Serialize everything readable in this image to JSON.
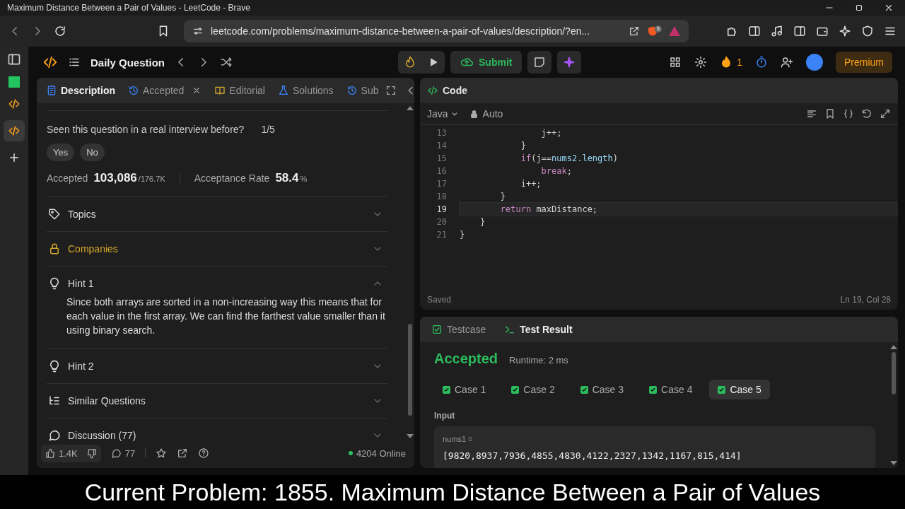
{
  "browser": {
    "title": "Maximum Distance Between a Pair of Values - LeetCode - Brave",
    "address": "leetcode.com/problems/maximum-distance-between-a-pair-of-values/description/?en...",
    "shield_count": "5"
  },
  "nav": {
    "title": "Daily Question",
    "submit": "Submit",
    "streak": "1",
    "premium": "Premium"
  },
  "left_panel": {
    "tabs": [
      {
        "label": "Description",
        "kind": "doc",
        "selected": true,
        "closable": false
      },
      {
        "label": "Accepted",
        "kind": "history",
        "selected": false,
        "closable": true
      },
      {
        "label": "Editorial",
        "kind": "book",
        "selected": false,
        "closable": false
      },
      {
        "label": "Solutions",
        "kind": "flask",
        "selected": false,
        "closable": false
      },
      {
        "label": "Sub",
        "kind": "history",
        "selected": false,
        "closable": false
      }
    ],
    "interview_question": "Seen this question in a real interview before?",
    "interview_count": "1/5",
    "answers": [
      "Yes",
      "No"
    ],
    "accepted_label": "Accepted",
    "accepted_value": "103,086",
    "accepted_total": "/176.7K",
    "rate_label": "Acceptance Rate",
    "rate_value": "58.4",
    "rate_unit": "%",
    "sections": [
      {
        "label": "Topics",
        "kind": "tag",
        "locked": false,
        "expanded": false
      },
      {
        "label": "Companies",
        "kind": "lock",
        "locked": true,
        "expanded": false
      },
      {
        "label": "Hint 1",
        "kind": "bulb",
        "locked": false,
        "expanded": true,
        "body": "Since both arrays are sorted in a non-increasing way this means that for each value in the first array. We can find the farthest value smaller than it using binary search."
      },
      {
        "label": "Hint 2",
        "kind": "bulb",
        "locked": false,
        "expanded": false
      },
      {
        "label": "Similar Questions",
        "kind": "list",
        "locked": false,
        "expanded": false
      },
      {
        "label": "Discussion (77)",
        "kind": "chat",
        "locked": false,
        "expanded": false
      }
    ],
    "likes": "1.4K",
    "comments": "77",
    "online": "4204 Online"
  },
  "code_panel": {
    "title": "Code",
    "language": "Java",
    "mode": "Auto",
    "status": "Saved",
    "cursor": "Ln 19, Col 28",
    "lines": [
      {
        "number": "13",
        "current": false,
        "tokens": [
          {
            "text": "                j++;",
            "kind": "plain"
          }
        ]
      },
      {
        "number": "14",
        "current": false,
        "tokens": [
          {
            "text": "            }",
            "kind": "plain"
          }
        ]
      },
      {
        "number": "15",
        "current": false,
        "tokens": [
          {
            "text": "            if",
            "kind": "keyword"
          },
          {
            "text": "(j==",
            "kind": "plain"
          },
          {
            "text": "nums2.length",
            "kind": "member"
          },
          {
            "text": ")",
            "kind": "plain"
          }
        ]
      },
      {
        "number": "16",
        "current": false,
        "tokens": [
          {
            "text": "                break",
            "kind": "keyword"
          },
          {
            "text": ";",
            "kind": "plain"
          }
        ]
      },
      {
        "number": "17",
        "current": false,
        "tokens": [
          {
            "text": "            i++;",
            "kind": "plain"
          }
        ]
      },
      {
        "number": "18",
        "current": false,
        "tokens": [
          {
            "text": "        }",
            "kind": "plain"
          }
        ]
      },
      {
        "number": "19",
        "current": true,
        "tokens": [
          {
            "text": "        return",
            "kind": "keyword"
          },
          {
            "text": " maxDistance;",
            "kind": "plain"
          }
        ]
      },
      {
        "number": "20",
        "current": false,
        "tokens": [
          {
            "text": "    }",
            "kind": "plain"
          }
        ]
      },
      {
        "number": "21",
        "current": false,
        "tokens": [
          {
            "text": "}",
            "kind": "plain"
          }
        ]
      }
    ]
  },
  "test_panel": {
    "tabs": [
      {
        "label": "Testcase",
        "kind": "check",
        "selected": false
      },
      {
        "label": "Test Result",
        "kind": "terminal",
        "selected": true
      }
    ],
    "verdict": "Accepted",
    "runtime": "Runtime: 2 ms",
    "cases": [
      {
        "label": "Case 1",
        "passed": true,
        "selected": false
      },
      {
        "label": "Case 2",
        "passed": true,
        "selected": false
      },
      {
        "label": "Case 3",
        "passed": true,
        "selected": false
      },
      {
        "label": "Case 4",
        "passed": true,
        "selected": false
      },
      {
        "label": "Case 5",
        "passed": true,
        "selected": true
      }
    ],
    "input_label": "Input",
    "variable": "nums1 =",
    "value": "[9820,8937,7936,4855,4830,4122,2327,1342,1167,815,414]"
  },
  "caption": "Current Problem: 1855. Maximum Distance Between a Pair of Values"
}
